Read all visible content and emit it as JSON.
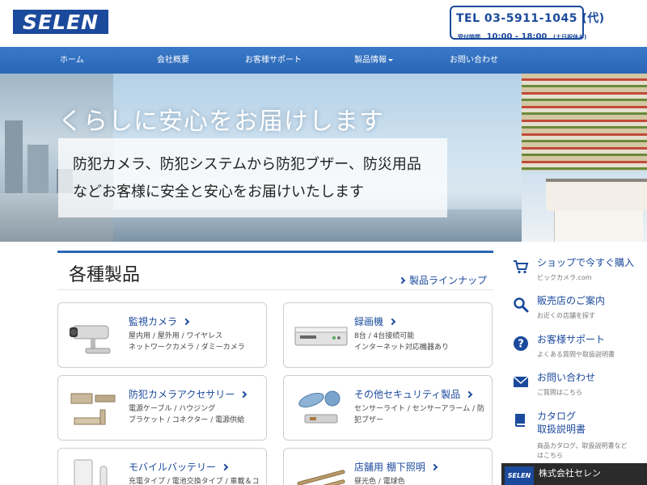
{
  "header": {
    "logo_text": "SELEN",
    "tel": "TEL 03-5911-1045 (代)",
    "hours_label": "受付時間",
    "hours_time": "10:00 - 18:00",
    "hours_days": "(土日祝休み)"
  },
  "nav": {
    "items": [
      {
        "label": "ホーム"
      },
      {
        "label": "会社概要"
      },
      {
        "label": "お客様サポート"
      },
      {
        "label": "製品情報"
      },
      {
        "label": "お問い合わせ"
      }
    ]
  },
  "hero": {
    "title": "くらしに安心をお届けします",
    "line1": "防犯カメラ、防犯システムから防犯ブザー、防災用品",
    "line2": "などお客様に安全と安心をお届けいたします"
  },
  "products": {
    "title": "各種製品",
    "lineup_link": "製品ラインナップ",
    "cards": [
      {
        "title": "監視カメラ",
        "desc1": "屋内用 / 屋外用 / ワイヤレス",
        "desc2": "ネットワークカメラ / ダミーカメラ",
        "icon": "security-camera-icon"
      },
      {
        "title": "録画機",
        "desc1": "8台 / 4台接続可能",
        "desc2": "インターネット対応機器あり",
        "icon": "recorder-icon"
      },
      {
        "title": "防犯カメラアクセサリー",
        "desc1": "電源ケーブル / ハウジング",
        "desc2": "ブラケット / コネクター / 電源供給",
        "icon": "camera-accessory-icon"
      },
      {
        "title": "その他セキュリティ製品",
        "desc1": "センサーライト / センサーアラーム / 防",
        "desc2": "犯ブザー",
        "icon": "security-products-icon"
      },
      {
        "title": "モバイルバッテリー",
        "desc1": "充電タイプ / 電池交換タイプ / 車載＆コ",
        "desc2": "",
        "icon": "mobile-battery-icon"
      },
      {
        "title": "店舗用 棚下照明",
        "desc1": "昼光色 / 電球色",
        "desc2": "",
        "icon": "shelf-light-icon"
      }
    ]
  },
  "sidebar": {
    "items": [
      {
        "title": "ショップで今すぐ購入",
        "sub": "ビックカメラ.com",
        "icon": "cart-icon"
      },
      {
        "title": "販売店のご案内",
        "sub": "お近くの店舗を探す",
        "icon": "search-icon"
      },
      {
        "title": "お客様サポート",
        "sub": "よくある質問や取扱説明書",
        "icon": "help-icon"
      },
      {
        "title": "お問い合わせ",
        "sub": "ご質問はこちら",
        "icon": "mail-icon"
      },
      {
        "title": "カタログ",
        "title2": "取扱説明書",
        "sub": "商品カタログ、取扱説明書など",
        "sub2": "はこちら",
        "icon": "book-icon"
      }
    ],
    "banner_logo": "SELEN",
    "banner_text": "株式会社セレン"
  }
}
